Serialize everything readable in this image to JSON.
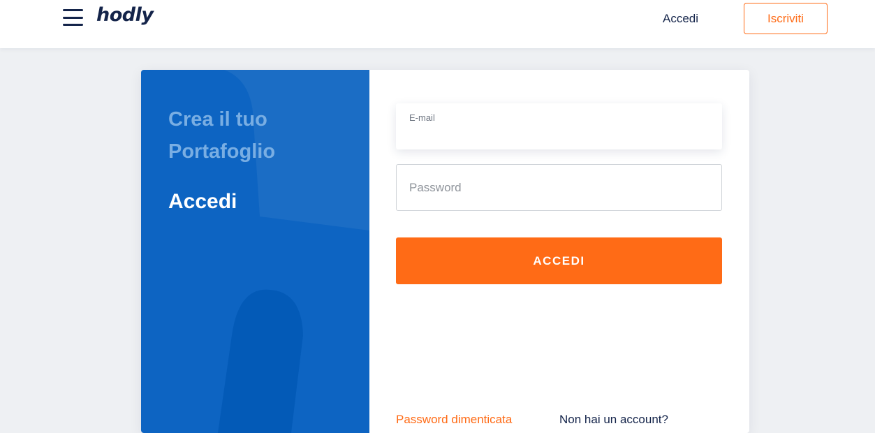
{
  "header": {
    "logo": "hodly",
    "login_link": "Accedi",
    "signup_button": "Iscriviti"
  },
  "side_panel": {
    "create_portfolio": "Crea il tuo Portafoglio",
    "active_section": "Accedi"
  },
  "form": {
    "email_label": "E-mail",
    "email_value": "",
    "password_placeholder": "Password",
    "password_value": "",
    "submit_label": "ACCEDI",
    "forgot_password": "Password dimenticata",
    "no_account": "Non hai un account?"
  },
  "colors": {
    "brand_navy": "#14244a",
    "accent_orange": "#ff6b16",
    "panel_blue": "#0d64c2",
    "panel_muted_text": "#79aee3",
    "page_bg": "#eef0f3"
  },
  "icons": {
    "menu": "hamburger-menu-icon"
  }
}
